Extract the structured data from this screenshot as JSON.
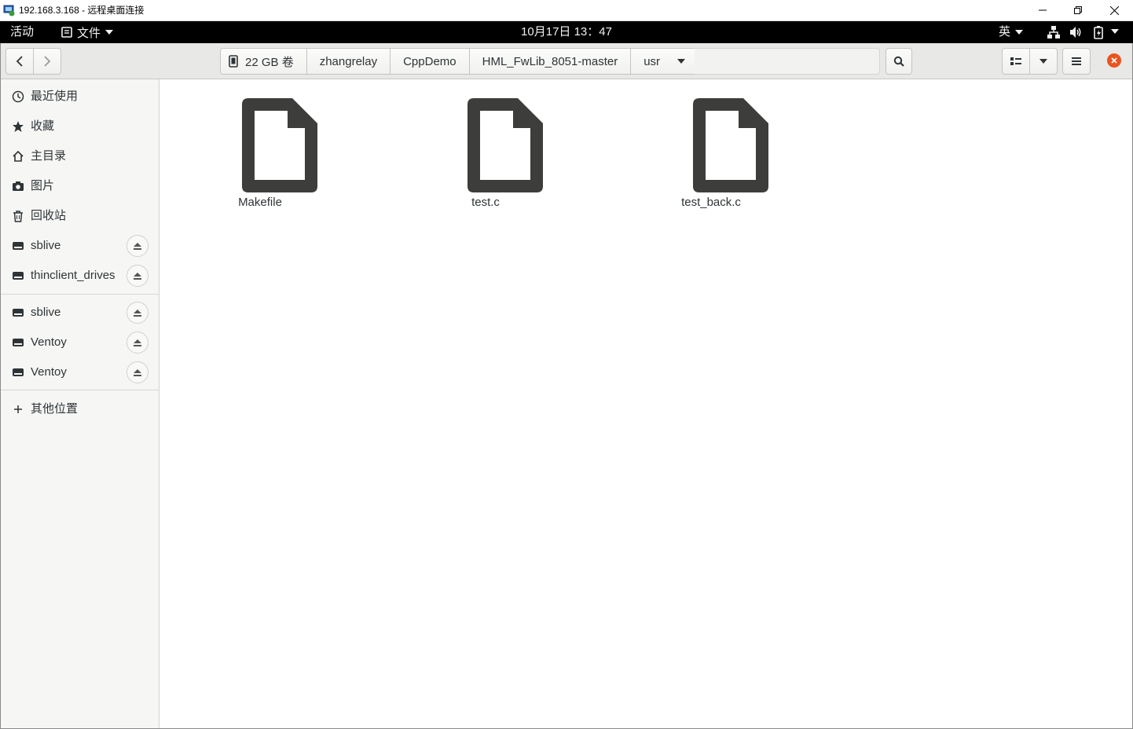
{
  "rdp": {
    "title": "192.168.3.168 - 远程桌面连接",
    "icon": "remote-desktop-icon",
    "controls": [
      "minimize-icon",
      "restore-icon",
      "close-icon"
    ]
  },
  "topbar": {
    "activities": "活动",
    "app_menu": "文件",
    "clock": "10月17日  13：47",
    "input_method": "英",
    "tray_icons": [
      "network-icon",
      "volume-icon",
      "battery-icon"
    ]
  },
  "header": {
    "path": [
      {
        "label": "22 GB 卷",
        "icon": "drive-icon"
      },
      {
        "label": "zhangrelay"
      },
      {
        "label": "CppDemo"
      },
      {
        "label": "HML_FwLib_8051-master"
      },
      {
        "label": "usr",
        "dropdown": true
      }
    ],
    "buttons": [
      "back-icon",
      "forward-icon",
      "search-icon",
      "list-view-icon",
      "chevron-down-icon",
      "hamburger-menu-icon",
      "close-icon"
    ],
    "accent_close": "#e95420"
  },
  "sidebar": {
    "places": [
      {
        "label": "最近使用",
        "icon": "clock-icon"
      },
      {
        "label": "收藏",
        "icon": "star-icon"
      },
      {
        "label": "主目录",
        "icon": "home-icon"
      },
      {
        "label": "图片",
        "icon": "camera-icon"
      },
      {
        "label": "回收站",
        "icon": "trash-icon"
      }
    ],
    "network_drives": [
      {
        "label": "sblive",
        "icon": "drive-icon"
      },
      {
        "label": "thinclient_drives",
        "icon": "drive-icon"
      }
    ],
    "devices": [
      {
        "label": "sblive",
        "icon": "drive-icon"
      },
      {
        "label": "Ventoy",
        "icon": "drive-icon"
      },
      {
        "label": "Ventoy",
        "icon": "drive-icon"
      }
    ],
    "other_locations": {
      "label": "其他位置",
      "icon": "plus-icon"
    }
  },
  "files": [
    {
      "name": "Makefile",
      "icon": "document-icon"
    },
    {
      "name": "test.c",
      "icon": "document-icon"
    },
    {
      "name": "test_back.c",
      "icon": "document-icon"
    }
  ],
  "colors": {
    "topbar": "#000000",
    "headerbar": "#e8e8e7",
    "sidebar": "#f6f6f5",
    "file_icon": "#3d3d3b"
  }
}
